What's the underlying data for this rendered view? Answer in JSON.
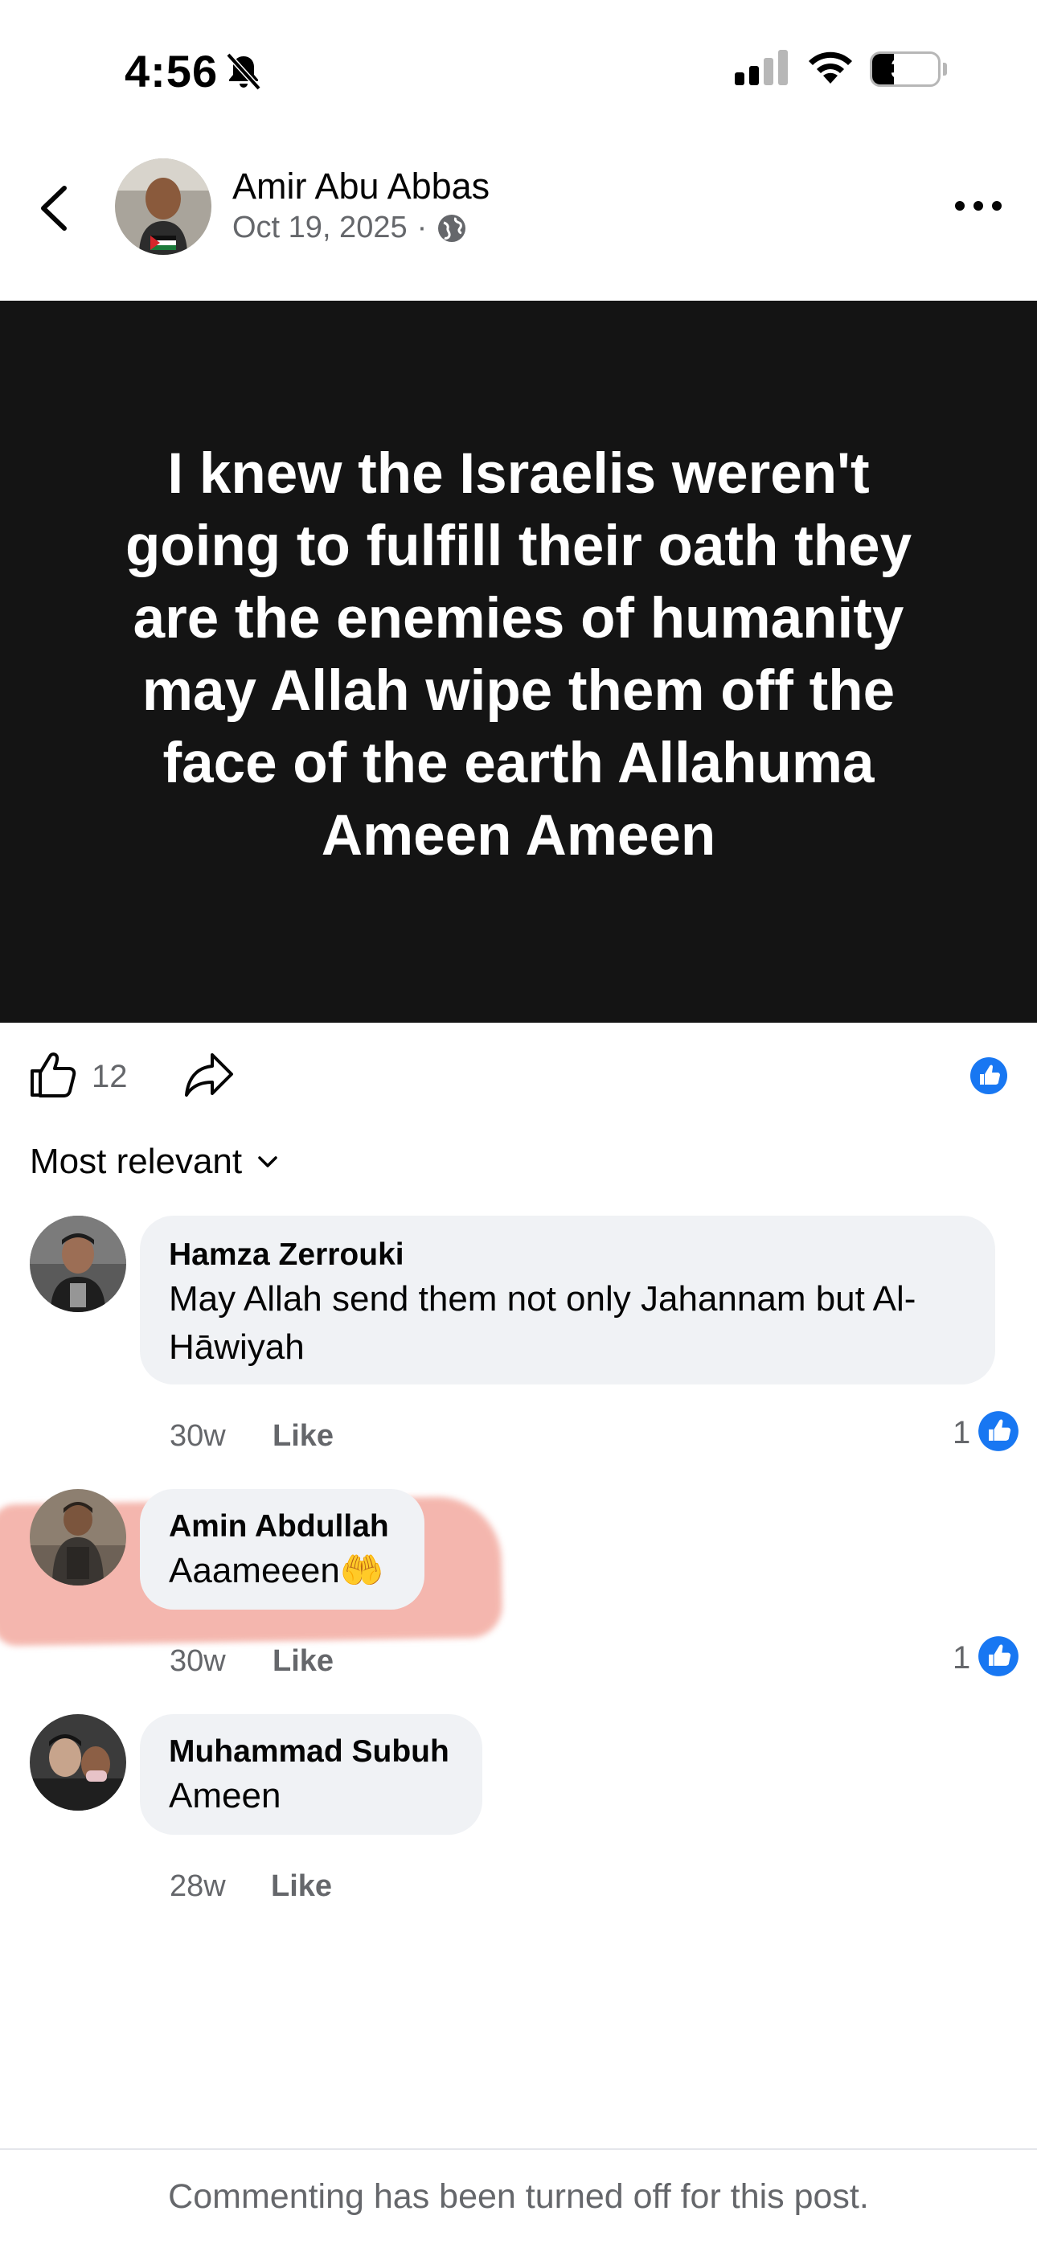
{
  "status_bar": {
    "time": "4:56",
    "battery": "33",
    "battery_level": 0.33
  },
  "header": {
    "author": "Amir Abu Abbas",
    "date": "Oct 19, 2025",
    "separator": "·"
  },
  "post": {
    "text": "I knew the Israelis weren't going to fulfill their oath they are the enemies of humanity may Allah wipe them off the face of the earth Allahuma Ameen Ameen",
    "background_color": "#141414"
  },
  "actions": {
    "like_count": "12"
  },
  "sort": {
    "label": "Most relevant"
  },
  "comments": [
    {
      "name": "Hamza Zerrouki",
      "text_line1": "May Allah send them not only Jahannam but  Al-",
      "text_line2": "Hāwiyah",
      "time": "30w",
      "like_label": "Like",
      "reaction_count": "1"
    },
    {
      "name": "Amin Abdullah",
      "text": "Aaameeen🤲",
      "time": "30w",
      "like_label": "Like",
      "reaction_count": "1"
    },
    {
      "name": "Muhammad Subuh",
      "text": "Ameen",
      "time": "28w",
      "like_label": "Like"
    }
  ],
  "footer": {
    "text": "Commenting has been turned off for this post."
  },
  "colors": {
    "facebook_blue": "#1877f2",
    "secondary_text": "#65676b",
    "bubble": "#f0f2f5",
    "highlight": "#f2a59a"
  },
  "icons": [
    "bell-slash-icon",
    "signal-icon",
    "wifi-icon",
    "battery-icon",
    "back-chevron-icon",
    "globe-icon",
    "more-icon",
    "thumbs-up-icon",
    "share-icon",
    "like-reaction-icon",
    "chevron-down-icon"
  ]
}
